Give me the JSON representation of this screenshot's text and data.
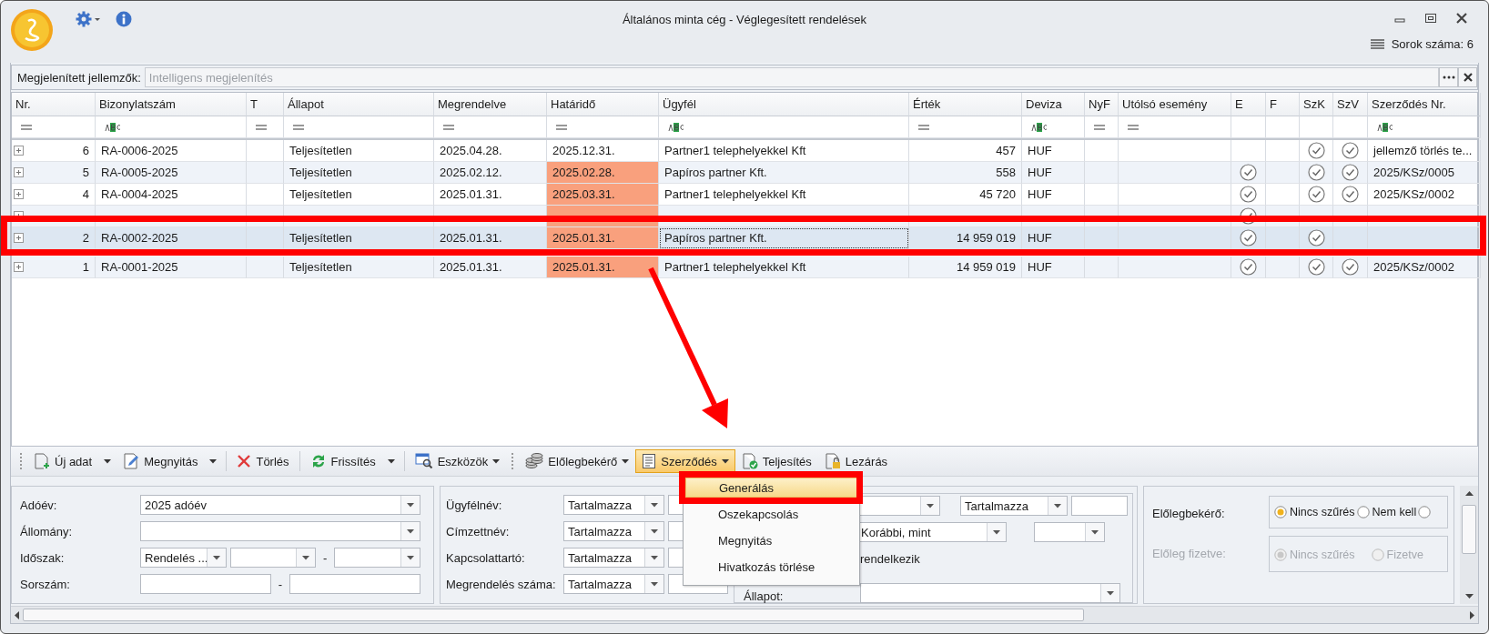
{
  "window": {
    "title": "Általános minta cég - Véglegesített rendelések",
    "row_count": "Sorok száma: 6"
  },
  "display_bar": {
    "label": "Megjelenített jellemzők:",
    "placeholder": "Intelligens megjelenítés"
  },
  "table": {
    "columns": [
      {
        "label": "Nr.",
        "kind": "row_number"
      },
      {
        "label": "Bizonylatszám",
        "kind": "text"
      },
      {
        "label": "T",
        "kind": "text"
      },
      {
        "label": "Állapot",
        "kind": "text"
      },
      {
        "label": "Megrendelve",
        "kind": "text"
      },
      {
        "label": "Határidő",
        "kind": "deadline"
      },
      {
        "label": "Ügyfél",
        "kind": "text"
      },
      {
        "label": "Érték",
        "kind": "amount"
      },
      {
        "label": "Deviza",
        "kind": "text"
      },
      {
        "label": "NyF",
        "kind": "text"
      },
      {
        "label": "Utólsó esemény",
        "kind": "text"
      },
      {
        "label": "E",
        "kind": "check"
      },
      {
        "label": "F",
        "kind": "check"
      },
      {
        "label": "SzK",
        "kind": "check"
      },
      {
        "label": "SzV",
        "kind": "check"
      },
      {
        "label": "Szerződés Nr.",
        "kind": "text"
      }
    ],
    "rows": [
      {
        "selected": false,
        "highlighted": false,
        "overdue": false,
        "cells": [
          "6",
          "RA-0006-2025",
          null,
          "Teljesítetlen",
          "2025.04.28.",
          "2025.12.31.",
          "Partner1 telephelyekkel Kft",
          "457",
          "HUF",
          null,
          null,
          false,
          false,
          true,
          true,
          "jellemző törlés te..."
        ]
      },
      {
        "selected": false,
        "highlighted": false,
        "overdue": true,
        "cells": [
          "5",
          "RA-0005-2025",
          null,
          "Teljesítetlen",
          "2025.02.12.",
          "2025.02.28.",
          "Papíros partner Kft.",
          "558",
          "HUF",
          null,
          null,
          true,
          false,
          true,
          true,
          "2025/KSz/0005"
        ]
      },
      {
        "selected": false,
        "highlighted": false,
        "overdue": true,
        "cells": [
          "4",
          "RA-0004-2025",
          null,
          "Teljesítetlen",
          "2025.01.31.",
          "2025.03.31.",
          "Partner1 telephelyekkel Kft",
          "45 720",
          "HUF",
          null,
          null,
          true,
          false,
          true,
          true,
          "2025/KSz/0002"
        ]
      },
      {
        "selected": false,
        "highlighted": false,
        "overdue": true,
        "cells": [
          null,
          null,
          null,
          null,
          null,
          null,
          null,
          null,
          null,
          null,
          null,
          true,
          false,
          false,
          false,
          null
        ]
      },
      {
        "selected": true,
        "highlighted": true,
        "overdue": true,
        "cells": [
          "2",
          "RA-0002-2025",
          null,
          "Teljesítetlen",
          "2025.01.31.",
          "2025.01.31.",
          "Papíros partner Kft.",
          "14 959 019",
          "HUF",
          null,
          null,
          true,
          false,
          true,
          false,
          null
        ]
      },
      {
        "selected": false,
        "highlighted": false,
        "overdue": true,
        "cells": [
          "1",
          "RA-0001-2025",
          null,
          "Teljesítetlen",
          "2025.01.31.",
          "2025.01.31.",
          "Partner1 telephelyekkel Kft",
          "14 959 019",
          "HUF",
          null,
          null,
          true,
          false,
          true,
          true,
          "2025/KSz/0002"
        ]
      }
    ]
  },
  "toolbar": {
    "items": [
      {
        "kind": "grip"
      },
      {
        "kind": "split_button",
        "label": "Új adat",
        "pressed": false
      },
      {
        "kind": "split_button",
        "label": "Megnyitás",
        "pressed": false
      },
      {
        "kind": "separator"
      },
      {
        "kind": "button",
        "label": "Törlés",
        "pressed": false
      },
      {
        "kind": "separator"
      },
      {
        "kind": "split_button",
        "label": "Frissítés",
        "pressed": false
      },
      {
        "kind": "separator"
      },
      {
        "kind": "menu_button",
        "label": "Eszközök",
        "pressed": false
      },
      {
        "kind": "grip"
      },
      {
        "kind": "menu_button",
        "label": "Előlegbekérő",
        "pressed": false
      },
      {
        "kind": "menu_button",
        "label": "Szerződés",
        "pressed": true
      },
      {
        "kind": "button",
        "label": "Teljesítés",
        "pressed": false
      },
      {
        "kind": "button",
        "label": "Lezárás",
        "pressed": false
      }
    ]
  },
  "menu": {
    "items": [
      {
        "label": "Generálás",
        "selected": true,
        "highlighted": true
      },
      {
        "label": "Oszekapcsolás",
        "selected": false,
        "highlighted": false
      },
      {
        "label": "Megnyitás",
        "selected": false,
        "highlighted": false
      },
      {
        "label": "Hivatkozás törlése",
        "selected": false,
        "highlighted": false
      }
    ]
  },
  "filters": {
    "left": [
      {
        "label": "Adóév:",
        "fields": [
          {
            "kind": "select",
            "value": "2025 adóév"
          }
        ]
      },
      {
        "label": "Állomány:",
        "fields": [
          {
            "kind": "select"
          }
        ]
      },
      {
        "label": "Időszak:",
        "fields": [
          {
            "kind": "select",
            "value": "Rendelés ..."
          },
          {
            "kind": "select"
          },
          {
            "kind": "dash",
            "text": "-"
          },
          {
            "kind": "select"
          }
        ]
      },
      {
        "label": "Sorszám:",
        "fields": [
          {
            "kind": "input"
          },
          {
            "kind": "dash",
            "text": "-"
          },
          {
            "kind": "input"
          }
        ]
      }
    ],
    "middle": [
      {
        "label": "Ügyfélnév:",
        "fields": [
          {
            "kind": "select",
            "value": "Tartalmazza"
          },
          {
            "kind": "input"
          }
        ]
      },
      {
        "label": "Címzettnév:",
        "fields": [
          {
            "kind": "select",
            "value": "Tartalmazza"
          },
          {
            "kind": "input"
          }
        ]
      },
      {
        "label": "Kapcsolattartó:",
        "fields": [
          {
            "kind": "select",
            "value": "Tartalmazza"
          },
          {
            "kind": "input"
          }
        ]
      },
      {
        "label": "Megrendelés száma:",
        "fields": [
          {
            "kind": "select",
            "value": "Tartalmazza"
          },
          {
            "kind": "input"
          }
        ]
      }
    ],
    "sub": [
      {
        "fields": [
          {
            "kind": "select"
          },
          {
            "kind": "select",
            "value": "Tartalmazza"
          },
          {
            "kind": "input"
          }
        ]
      },
      {
        "fields": [
          {
            "kind": "select",
            "value": "Korábbi, mint"
          },
          {
            "kind": "select"
          }
        ]
      },
      {
        "text": "rendelkezik"
      },
      {
        "label": "Állapot:",
        "fields": [
          {
            "kind": "select"
          }
        ]
      }
    ],
    "right": [
      {
        "label": "Előlegbekérő:",
        "disabled": false,
        "options": [
          {
            "label": "Nincs szűrés",
            "selected": true
          },
          {
            "label": "Nem kell",
            "selected": false
          },
          {
            "selected": false
          }
        ]
      },
      {
        "label": "Előleg fizetve:",
        "disabled": true,
        "options": [
          {
            "label": "Nincs szűrés",
            "selected": true
          },
          {
            "label": "Fizetve",
            "selected": false
          }
        ]
      }
    ]
  }
}
